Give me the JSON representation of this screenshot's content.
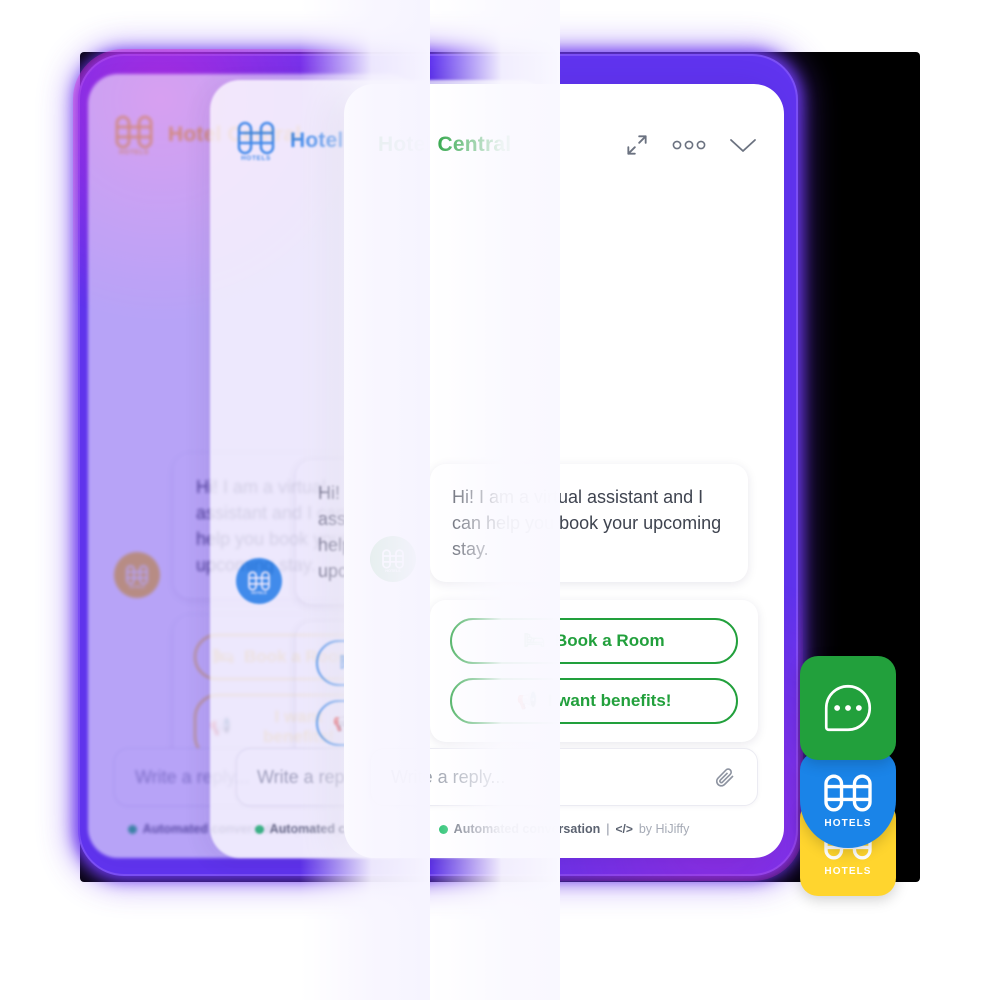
{
  "theme": {
    "glow_color": "#6034ef",
    "green": "#22a03c",
    "blue": "#1a84e8",
    "yellow": "#ffd52e",
    "status_green": "#1fc16b"
  },
  "cards": [
    {
      "id": "card-back",
      "accent": "#ffd52e",
      "title": "Hotel Central",
      "logo_label": "HOTELS",
      "message": "Hi! I am a virtual assistant and I can help you book your upcoming stay.",
      "replies": [
        {
          "emoji": "🛏",
          "label": "Book a Room"
        },
        {
          "emoji": "📢",
          "label": "I want benefits!"
        }
      ],
      "input_placeholder": "Write a reply...",
      "footer": {
        "status": "Automated conversation",
        "separator": "|",
        "code": "</>",
        "attribution": "by HiJiffy"
      }
    },
    {
      "id": "card-mid",
      "accent": "#1a84e8",
      "title": "Hotel Central",
      "logo_label": "HOTELS",
      "message": "Hi! I am a virtual assistant and I can help you book your upcoming stay.",
      "replies": [
        {
          "emoji": "🛏",
          "label": "Book a Room"
        },
        {
          "emoji": "📢",
          "label": "I want benefits!"
        }
      ],
      "input_placeholder": "Write a reply...",
      "footer": {
        "status": "Automated conversation",
        "separator": "|",
        "code": "</>",
        "attribution": "by HiJiffy"
      }
    },
    {
      "id": "card-front",
      "accent": "#22a03c",
      "title": "Hotel Central",
      "logo_label": "HOTELS",
      "message": "Hi! I am a virtual assistant and I can help you book your upcoming stay.",
      "replies": [
        {
          "emoji": "🛏",
          "label": "Book a Room"
        },
        {
          "emoji": "📢",
          "label": "I want benefits!"
        }
      ],
      "input_placeholder": "Write a reply...",
      "footer": {
        "status": "Automated conversation",
        "separator": "|",
        "code": "</>",
        "attribution": "by HiJiffy"
      },
      "header_icons": [
        "expand-icon",
        "more-options-icon",
        "collapse-chevron-icon"
      ]
    }
  ],
  "launchers": [
    {
      "id": "launcher-chat",
      "icon": "chat-bubble-icon",
      "color": "#22a03c",
      "label": ""
    },
    {
      "id": "launcher-blue",
      "icon": "hotels-logo-icon",
      "color": "#1a84e8",
      "label": "HOTELS"
    },
    {
      "id": "launcher-yellow",
      "icon": "hotels-logo-icon",
      "color": "#ffd52e",
      "label": "HOTELS"
    }
  ]
}
